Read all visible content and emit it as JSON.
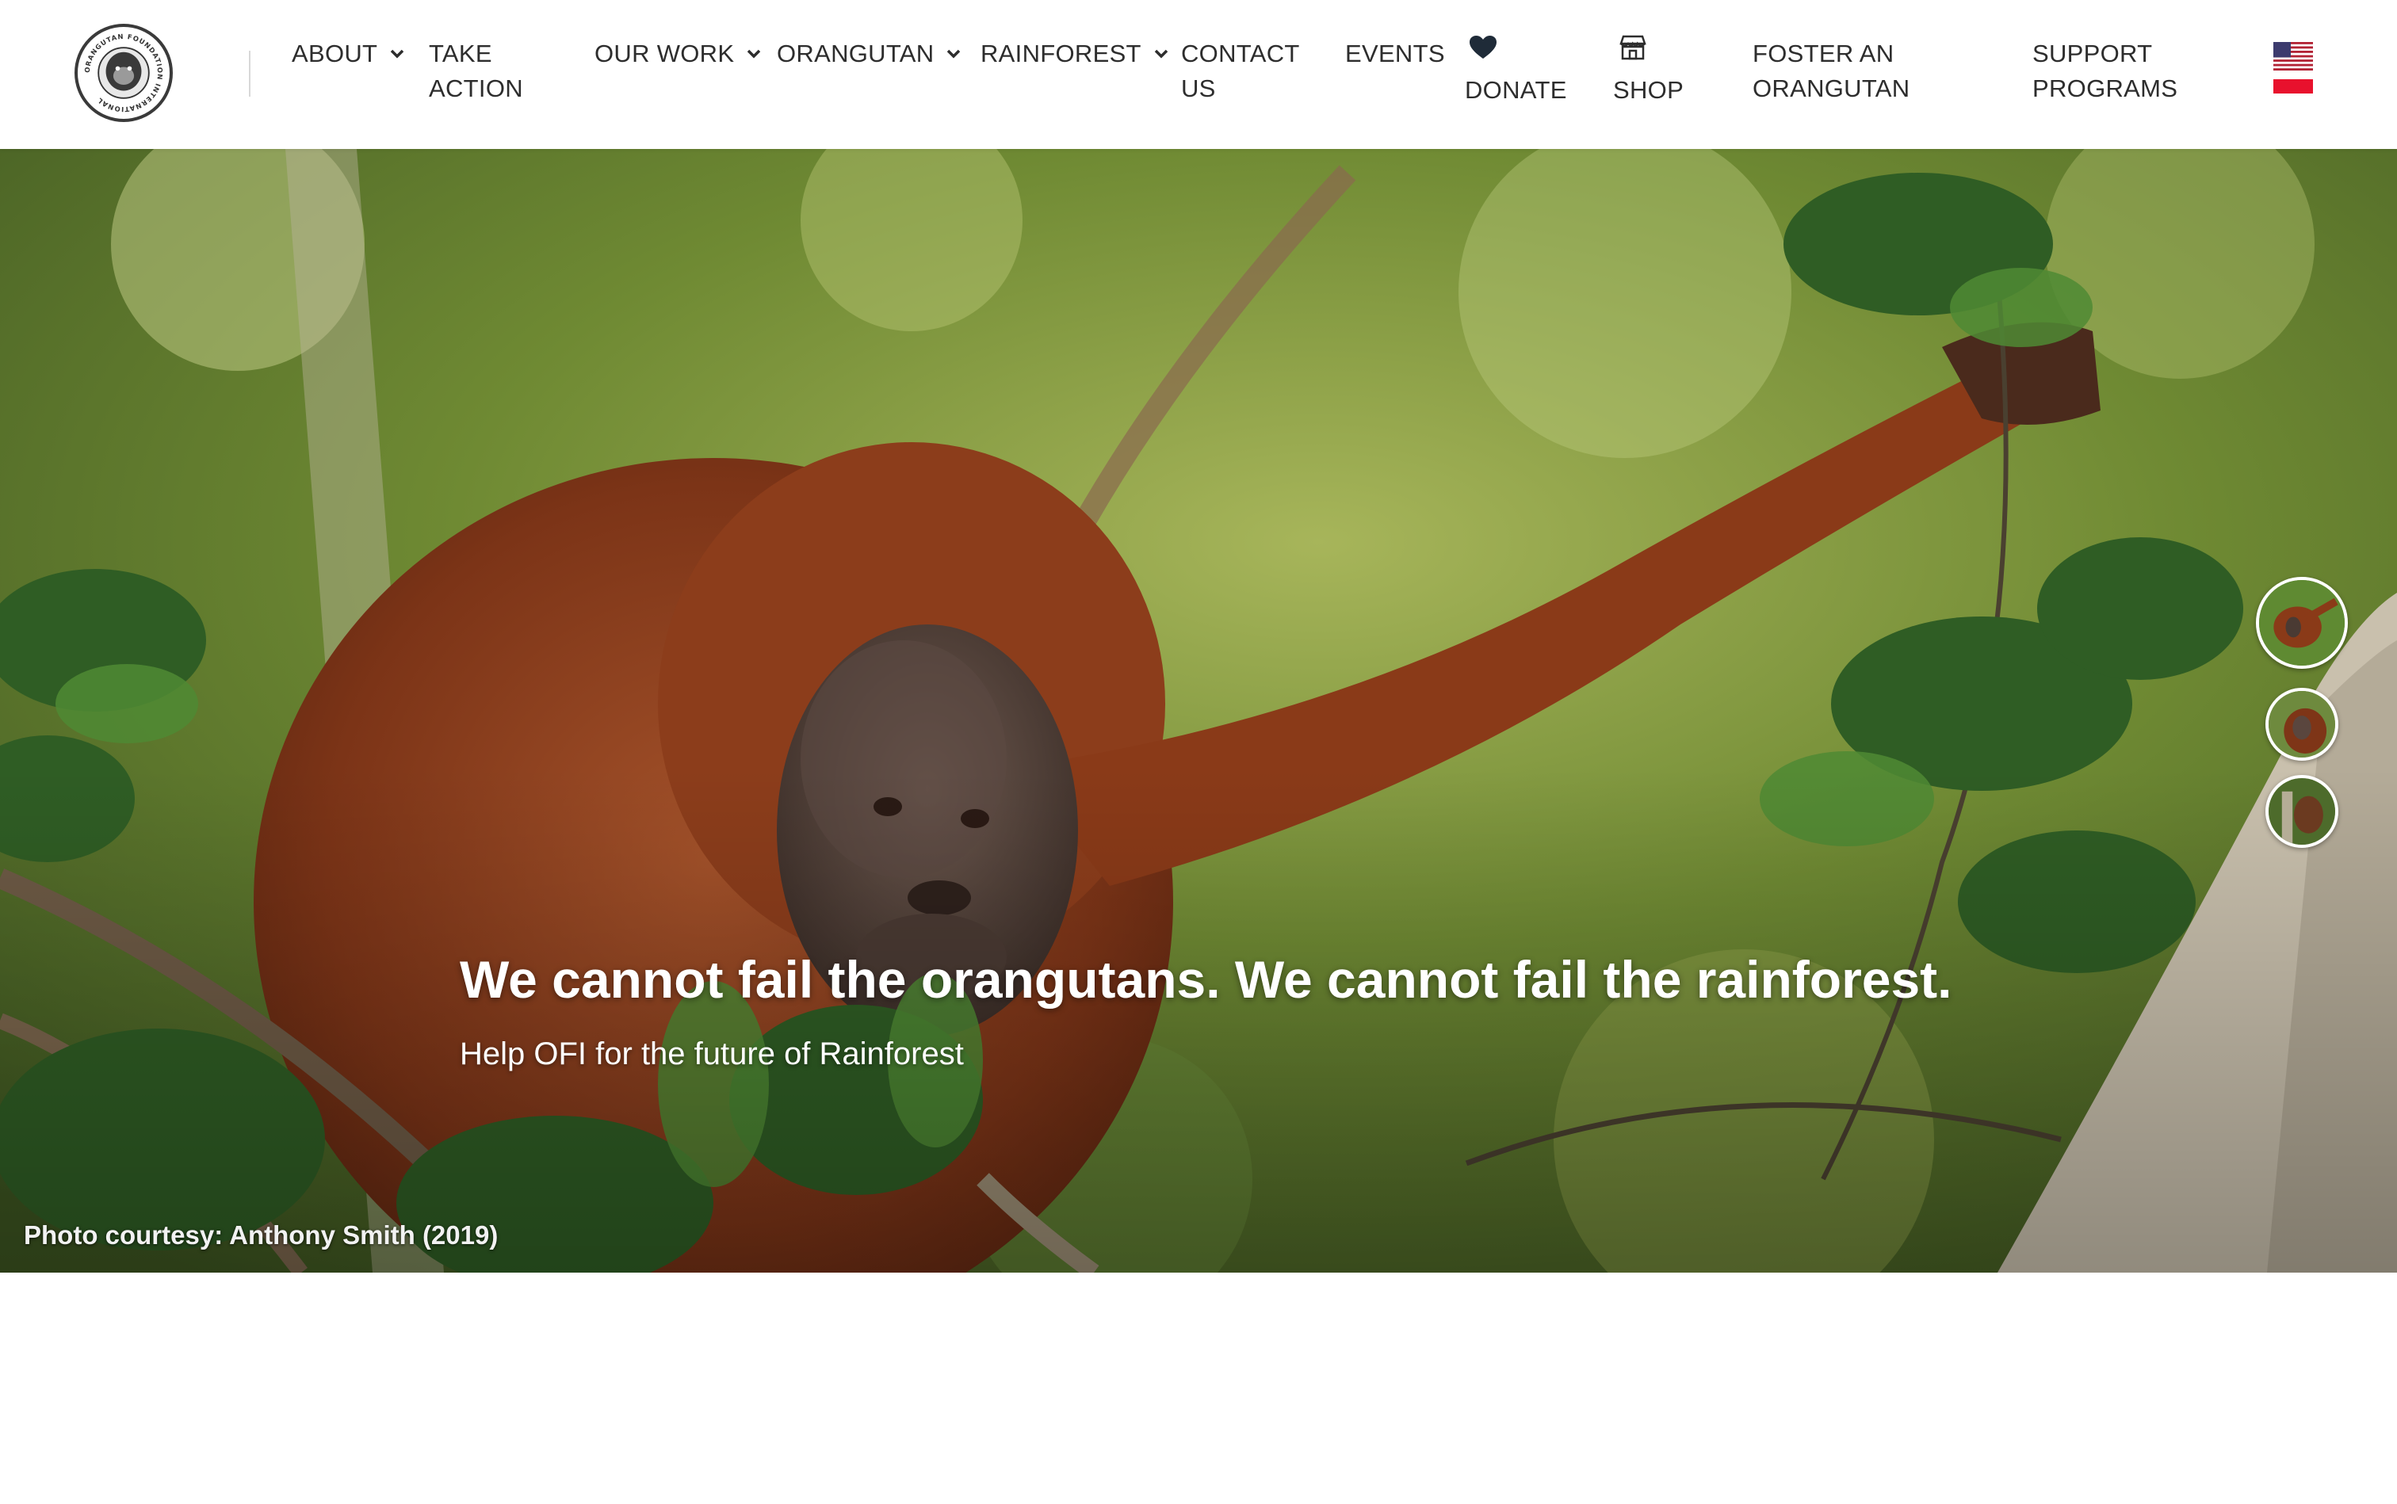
{
  "header": {
    "logo_ring_text": "ORANGUTAN FOUNDATION INTERNATIONAL",
    "nav": {
      "about": "ABOUT",
      "take_action_1": "TAKE",
      "take_action_2": "ACTION",
      "our_work": "OUR WORK",
      "orangutan": "ORANGUTAN",
      "rainforest": "RAINFOREST",
      "contact_1": "CONTACT",
      "contact_2": "US",
      "events": "EVENTS",
      "donate": "DONATE",
      "shop": "SHOP",
      "foster_1": "FOSTER AN",
      "foster_2": "ORANGUTAN",
      "support_1": "SUPPORT",
      "support_2": "PROGRAMS"
    },
    "icons": {
      "donate": "heart-icon",
      "shop": "storefront-icon",
      "dropdown": "chevron-down-icon"
    },
    "languages": [
      "flag-us-icon",
      "flag-indonesia-icon"
    ]
  },
  "hero": {
    "title": "We cannot fail the orangutans. We cannot fail the rainforest.",
    "subtitle": "Help OFI for the future of Rainforest",
    "credit": "Photo courtesy: Anthony Smith (2019)",
    "slides": 3,
    "active_slide": 1
  },
  "colors": {
    "text": "#2d2d2d",
    "hero_text": "#ffffff",
    "foliage": "#5e7f2f",
    "fur": "#8a3a18"
  }
}
